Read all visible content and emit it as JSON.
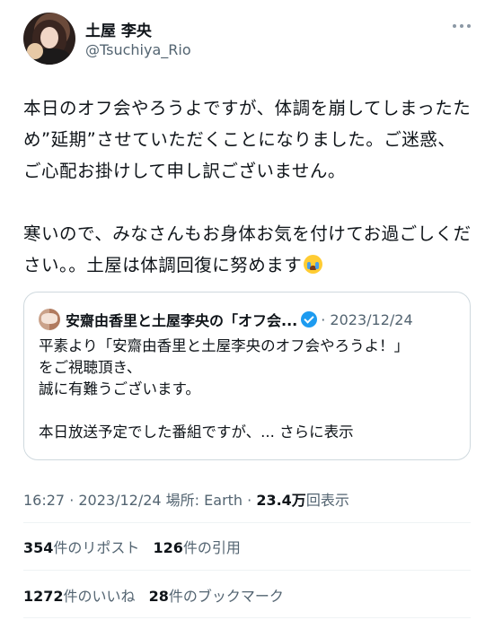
{
  "author": {
    "name": "土屋 李央",
    "handle": "@Tsuchiya_Rio"
  },
  "tweet": {
    "paragraph1": "本日のオフ会やろうよですが、体調を崩してしまったため”延期”させていただくことになりました。ご迷惑、ご心配お掛けして申し訳ございません。",
    "paragraph2": "寒いので、みなさんもお身体お気を付けてお過ごしください。。土屋は体調回復に努めます",
    "emoji": "loudly-crying-face"
  },
  "quote": {
    "name": "安齋由香里と土屋李央の「オフ会...",
    "date": "· 2023/12/24",
    "body": "平素より「安齋由香里と土屋李央のオフ会やろうよ！」\nをご視聴頂き、\n誠に有難うございます。\n\n本日放送予定でした番組ですが、...",
    "show_more": "さらに表示"
  },
  "meta": {
    "time": "16:27 · 2023/12/24 場所: Earth · ",
    "views": "23.4万",
    "views_label": "回表示"
  },
  "stats": {
    "reposts": "354",
    "reposts_label": "件のリポスト",
    "quotes": "126",
    "quotes_label": "件の引用",
    "likes": "1272",
    "likes_label": "件のいいね",
    "bookmarks": "28",
    "bookmarks_label": "件のブックマーク"
  },
  "colors": {
    "text": "#0f1419",
    "secondary": "#536471",
    "verified": "#1d9bf0",
    "border": "#cfd9de"
  }
}
